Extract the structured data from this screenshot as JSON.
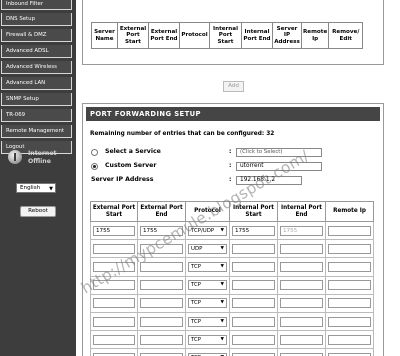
{
  "sidebar": {
    "items": [
      {
        "label": "Inbound Filter"
      },
      {
        "label": "DNS Setup"
      },
      {
        "label": "Firewall & DMZ"
      },
      {
        "label": "Advanced ADSL"
      },
      {
        "label": "Advanced Wireless"
      },
      {
        "label": "Advanced LAN"
      },
      {
        "label": "SNMP Setup"
      },
      {
        "label": "TR-069"
      },
      {
        "label": "Remote Management"
      },
      {
        "label": "Logout"
      }
    ],
    "status_line1": "Internet",
    "status_line2": "Offline",
    "language_value": "English",
    "reboot_label": "Reboot"
  },
  "rules_table": {
    "columns": [
      "Server Name",
      "External Port Start",
      "External Port End",
      "Protocol",
      "Internal Port Start",
      "Internal Port End",
      "Server IP Address",
      "Remote Ip",
      "Remove/ Edit"
    ]
  },
  "add_label": "Add",
  "port_forwarding": {
    "title": "PORT FORWARDING SETUP",
    "remaining_label": "Remaining number of entries that can be configured:",
    "remaining_value": "32",
    "select_service_label": "Select a Service",
    "service_select_value": "(Click to Select)",
    "custom_server_label": "Custom Server",
    "custom_server_value": "utorrent",
    "server_ip_label": "Server IP Address",
    "server_ip_value": "192.168.1.2",
    "colon": ":",
    "selected_option": "custom_server"
  },
  "entries_table": {
    "columns": [
      "External Port Start",
      "External Port End",
      "Protocol",
      "Internal Port Start",
      "Internal Port End",
      "Remote Ip"
    ],
    "rows": [
      {
        "ext_start": "1755",
        "ext_end": "1755",
        "protocol": "TCP/UDP",
        "int_start": "1755",
        "int_end": "1755",
        "remote_ip": ""
      },
      {
        "ext_start": "",
        "ext_end": "",
        "protocol": "UDP",
        "int_start": "",
        "int_end": "",
        "remote_ip": ""
      },
      {
        "ext_start": "",
        "ext_end": "",
        "protocol": "TCP",
        "int_start": "",
        "int_end": "",
        "remote_ip": ""
      },
      {
        "ext_start": "",
        "ext_end": "",
        "protocol": "TCP",
        "int_start": "",
        "int_end": "",
        "remote_ip": ""
      },
      {
        "ext_start": "",
        "ext_end": "",
        "protocol": "TCP",
        "int_start": "",
        "int_end": "",
        "remote_ip": ""
      },
      {
        "ext_start": "",
        "ext_end": "",
        "protocol": "TCP",
        "int_start": "",
        "int_end": "",
        "remote_ip": ""
      },
      {
        "ext_start": "",
        "ext_end": "",
        "protocol": "TCP",
        "int_start": "",
        "int_end": "",
        "remote_ip": ""
      },
      {
        "ext_start": "",
        "ext_end": "",
        "protocol": "TCP",
        "int_start": "",
        "int_end": "",
        "remote_ip": ""
      }
    ]
  },
  "watermark": "http://mypcemule.blogspot.com/",
  "colors": {
    "sidebar_bg": "#3d3d3d",
    "nav_item_bg": "#4a4a4a",
    "header_bg": "#454545"
  },
  "icons": {
    "status": "globe-icon",
    "dropdown": "chevron-down-icon"
  }
}
